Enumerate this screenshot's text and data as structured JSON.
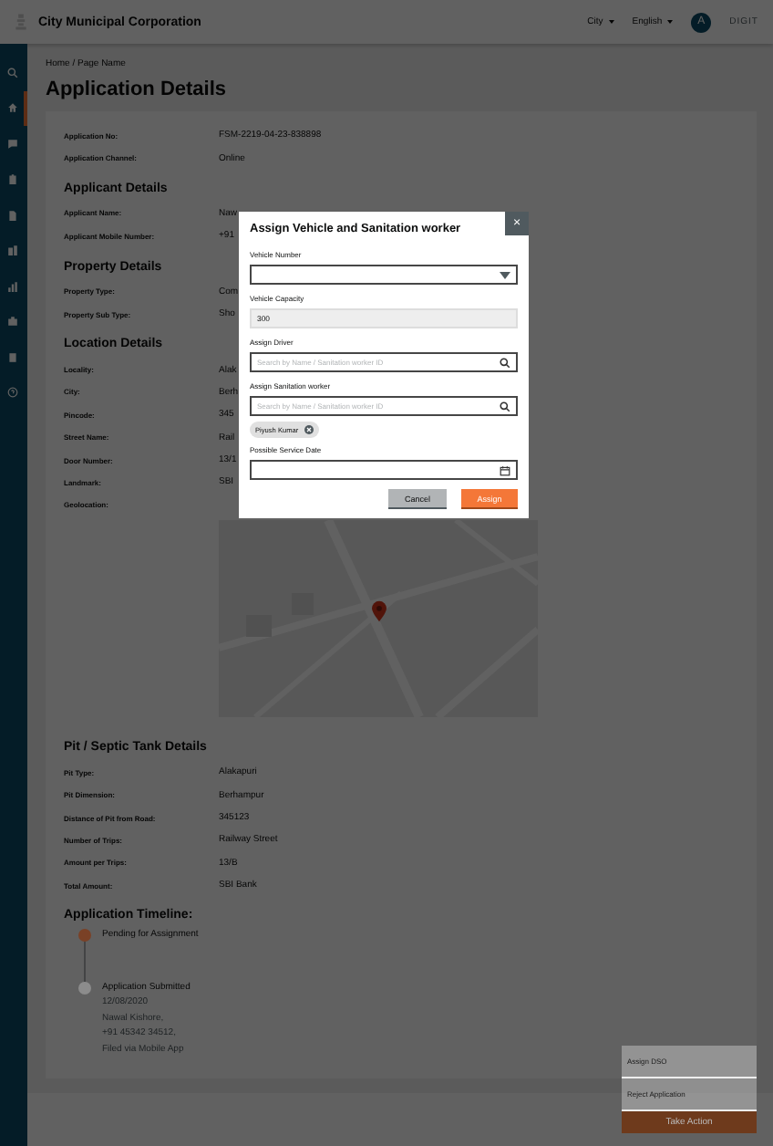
{
  "header": {
    "title": "City Municipal Corporation",
    "city": "City",
    "language": "English",
    "avatar": "A",
    "brand": "DIGIT"
  },
  "sidebar": {
    "items": [
      {
        "kind": "search",
        "selected": false
      },
      {
        "kind": "home",
        "selected": true
      },
      {
        "kind": "chat",
        "selected": false
      },
      {
        "kind": "clipboard",
        "selected": false
      },
      {
        "kind": "document",
        "selected": false
      },
      {
        "kind": "building",
        "selected": false
      },
      {
        "kind": "chart",
        "selected": false
      },
      {
        "kind": "briefcase",
        "selected": false
      },
      {
        "kind": "book",
        "selected": false
      },
      {
        "kind": "help",
        "selected": false
      }
    ]
  },
  "breadcrumb": "Home / Page Name",
  "page_title": "Application Details",
  "sections": [
    {
      "rows": [
        {
          "label": "Application No:",
          "value": "FSM-2219-04-23-838898"
        },
        {
          "label": "Application Channel:",
          "value": "Online"
        }
      ]
    },
    {
      "heading": "Applicant Details",
      "rows": [
        {
          "label": "Applicant Name:",
          "value": "Naw"
        },
        {
          "label": "Applicant Mobile Number:",
          "value": "+91"
        }
      ]
    },
    {
      "heading": "Property Details",
      "rows": [
        {
          "label": "Property Type:",
          "value": "Com"
        },
        {
          "label": "Property Sub Type:",
          "value": "Sho"
        }
      ]
    },
    {
      "heading": "Location Details",
      "rows": [
        {
          "label": "Locality:",
          "value": "Alak"
        },
        {
          "label": "City:",
          "value": "Berh"
        },
        {
          "label": "Pincode:",
          "value": "345"
        },
        {
          "label": "Street Name:",
          "value": "Rail"
        },
        {
          "label": "Door Number:",
          "value": "13/1"
        },
        {
          "label": "Landmark:",
          "value": "SBI"
        },
        {
          "label": "Geolocation:",
          "value": null
        }
      ]
    }
  ],
  "pit_details": {
    "heading": "Pit / Septic Tank Details",
    "rows": [
      {
        "label": "Pit Type:",
        "value": "Alakapuri"
      },
      {
        "label": "Pit Dimension:",
        "value": "Berhampur"
      },
      {
        "label": "Distance of Pit from Road:",
        "value": "345123"
      },
      {
        "label": "Number of Trips:",
        "value": "Railway Street"
      },
      {
        "label": "Amount per Trips:",
        "value": "13/B"
      },
      {
        "label": "Total Amount:",
        "value": "SBI Bank"
      }
    ]
  },
  "timeline": {
    "heading": "Application Timeline:",
    "items": [
      {
        "color": "#7a4126",
        "lines": [
          "Pending for Assignment"
        ]
      },
      {
        "color": "#8c8c8c",
        "lines": [
          "Application Submitted",
          "12/08/2020",
          "Nawal Kishore,",
          "+91 45342 34512,",
          "Filed via Mobile App"
        ]
      }
    ]
  },
  "action_menu": {
    "items": [
      "Assign DSO",
      "Reject Application"
    ],
    "button": "Take Action"
  },
  "modal": {
    "title": "Assign Vehicle and Sanitation worker",
    "close": "×",
    "fields": [
      {
        "kind": "dropdown",
        "label": "Vehicle Number"
      },
      {
        "kind": "readonly",
        "label": "Vehicle Capacity",
        "value": "300"
      },
      {
        "kind": "search",
        "label": "Assign Driver",
        "placeholder": "Search by Name / Sanitation worker ID"
      },
      {
        "kind": "search",
        "label": "Assign Sanitation worker",
        "placeholder": "Search by Name / Sanitation worker ID",
        "chips": [
          "Piyush Kumar"
        ]
      },
      {
        "kind": "date",
        "label": "Possible Service Date"
      }
    ],
    "buttons": {
      "cancel": "Cancel",
      "confirm": "Assign"
    }
  }
}
